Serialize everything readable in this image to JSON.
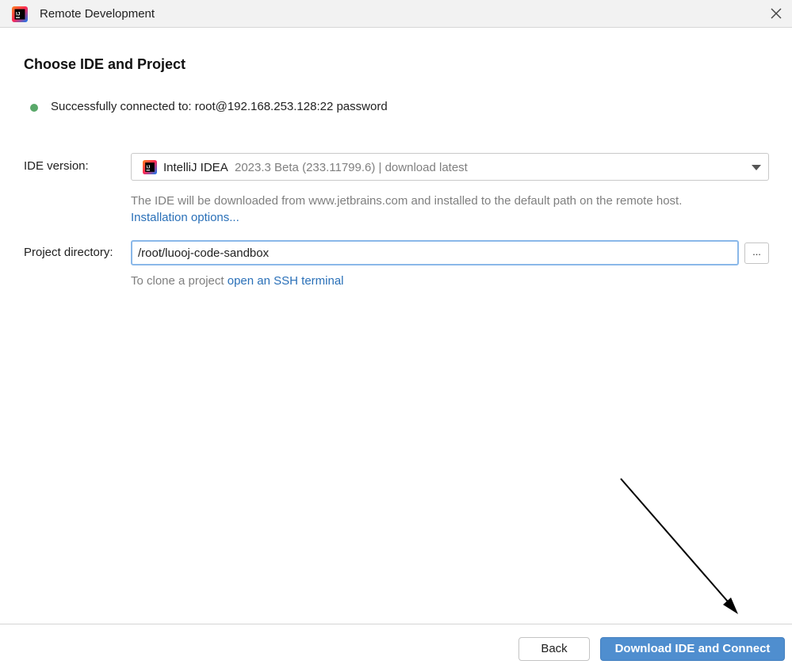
{
  "window": {
    "title": "Remote Development",
    "app_icon": "intellij-idea-icon",
    "close_icon": "close-icon"
  },
  "page": {
    "heading": "Choose IDE and Project",
    "status_text": "Successfully connected to: root@192.168.253.128:22 password",
    "status_color": "#59a869"
  },
  "ide": {
    "label": "IDE version:",
    "selected_name": "IntelliJ IDEA",
    "selected_version": "2023.3 Beta (233.11799.6) | download latest",
    "hint": "The IDE will be downloaded from www.jetbrains.com and installed to the default path on the remote host.",
    "install_link": "Installation options..."
  },
  "project": {
    "label": "Project directory:",
    "value": "/root/luooj-code-sandbox",
    "browse_label": "...",
    "clone_prefix": "To clone a project ",
    "clone_link": "open an SSH terminal"
  },
  "footer": {
    "back_label": "Back",
    "primary_label": "Download IDE and Connect"
  },
  "colors": {
    "link": "#2a70b8",
    "primary_button": "#4f8ecf",
    "focus_border": "#8ab8e9"
  }
}
